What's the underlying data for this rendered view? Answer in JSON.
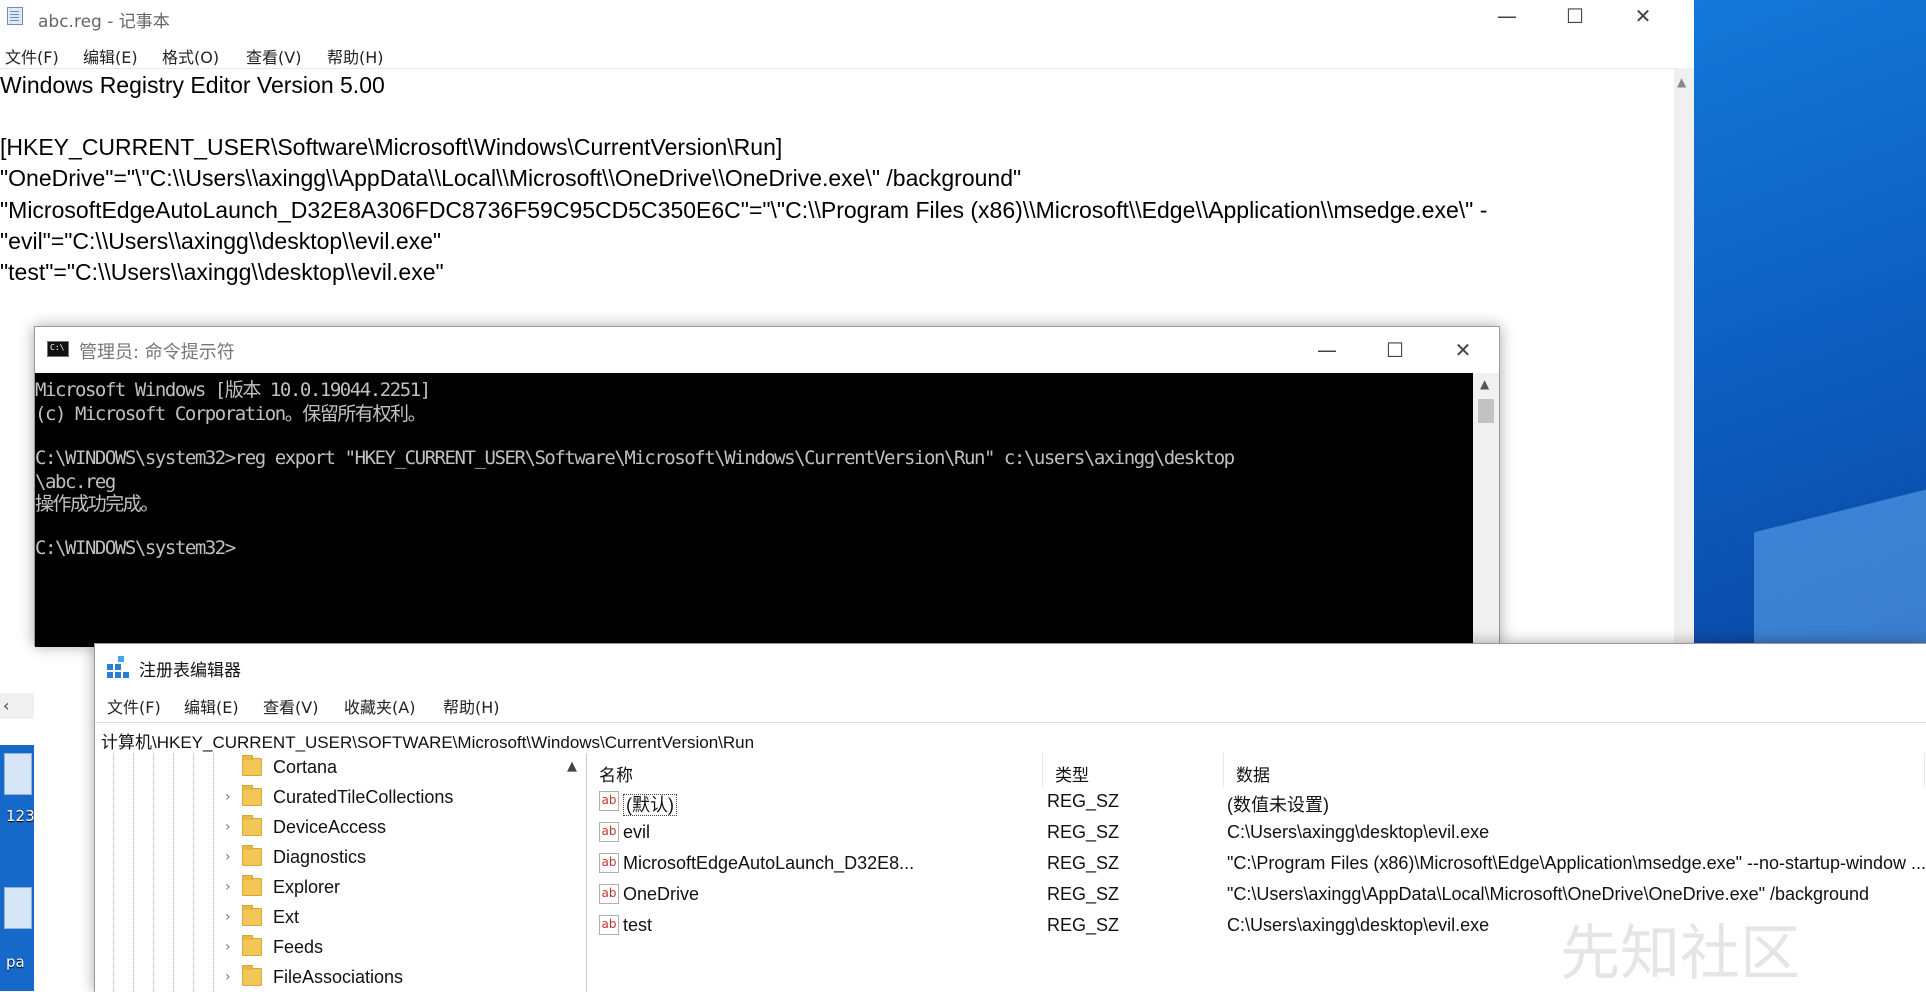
{
  "notepad": {
    "title": "abc.reg - 记事本",
    "menu": [
      "文件(F)",
      "编辑(E)",
      "格式(O)",
      "查看(V)",
      "帮助(H)"
    ],
    "lines": [
      "Windows Registry Editor Version 5.00",
      "",
      "[HKEY_CURRENT_USER\\Software\\Microsoft\\Windows\\CurrentVersion\\Run]",
      "\"OneDrive\"=\"\\\"C:\\\\Users\\\\axingg\\\\AppData\\\\Local\\\\Microsoft\\\\OneDrive\\\\OneDrive.exe\\\" /background\"",
      "\"MicrosoftEdgeAutoLaunch_D32E8A306FDC8736F59C95CD5C350E6C\"=\"\\\"C:\\\\Program Files (x86)\\\\Microsoft\\\\Edge\\\\Application\\\\msedge.exe\\\" -",
      "\"evil\"=\"C:\\\\Users\\\\axingg\\\\desktop\\\\evil.exe\"",
      "\"test\"=\"C:\\\\Users\\\\axingg\\\\desktop\\\\evil.exe\""
    ]
  },
  "cmd": {
    "title": "管理员: 命令提示符",
    "lines": [
      "Microsoft Windows [版本 10.0.19044.2251]",
      "(c) Microsoft Corporation。保留所有权利。",
      "",
      "C:\\WINDOWS\\system32>reg export \"HKEY_CURRENT_USER\\Software\\Microsoft\\Windows\\CurrentVersion\\Run\" c:\\users\\axingg\\desktop",
      "\\abc.reg",
      "操作成功完成。",
      "",
      "C:\\WINDOWS\\system32>"
    ]
  },
  "regedit": {
    "title": "注册表编辑器",
    "menu": [
      "文件(F)",
      "编辑(E)",
      "查看(V)",
      "收藏夹(A)",
      "帮助(H)"
    ],
    "address": "计算机\\HKEY_CURRENT_USER\\SOFTWARE\\Microsoft\\Windows\\CurrentVersion\\Run",
    "tree": [
      {
        "label": "Cortana",
        "expandable": false
      },
      {
        "label": "CuratedTileCollections",
        "expandable": true
      },
      {
        "label": "DeviceAccess",
        "expandable": true
      },
      {
        "label": "Diagnostics",
        "expandable": true
      },
      {
        "label": "Explorer",
        "expandable": true
      },
      {
        "label": "Ext",
        "expandable": true
      },
      {
        "label": "Feeds",
        "expandable": true
      },
      {
        "label": "FileAssociations",
        "expandable": true
      }
    ],
    "columns": {
      "name": "名称",
      "type": "类型",
      "data": "数据"
    },
    "values": [
      {
        "name": "(默认)",
        "type": "REG_SZ",
        "data": "(数值未设置)"
      },
      {
        "name": "evil",
        "type": "REG_SZ",
        "data": "C:\\Users\\axingg\\desktop\\evil.exe"
      },
      {
        "name": "MicrosoftEdgeAutoLaunch_D32E8...",
        "type": "REG_SZ",
        "data": "\"C:\\Program Files (x86)\\Microsoft\\Edge\\Application\\msedge.exe\" --no-startup-window ..."
      },
      {
        "name": "OneDrive",
        "type": "REG_SZ",
        "data": "\"C:\\Users\\axingg\\AppData\\Local\\Microsoft\\OneDrive\\OneDrive.exe\" /background"
      },
      {
        "name": "test",
        "type": "REG_SZ",
        "data": "C:\\Users\\axingg\\desktop\\evil.exe"
      }
    ]
  },
  "desktop": {
    "icon_labels": [
      "123",
      "pa"
    ]
  },
  "watermark": "先知社区",
  "icons": {
    "window_minimize": "—",
    "window_maximize": "☐",
    "window_close": "✕",
    "value_string": "ab"
  }
}
